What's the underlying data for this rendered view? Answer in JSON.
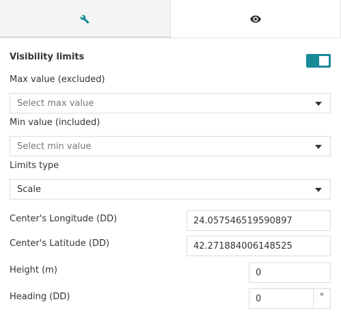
{
  "tabs": [
    {
      "icon": "wrench-icon",
      "active": true
    },
    {
      "icon": "eye-icon",
      "active": false
    }
  ],
  "visibility_limits": {
    "title": "Visibility limits",
    "toggle_on": true,
    "max_label": "Max value (excluded)",
    "max_placeholder": "Select max value",
    "min_label": "Min value (included)",
    "min_placeholder": "Select min value",
    "type_label": "Limits type",
    "type_value": "Scale"
  },
  "fields": {
    "longitude_label": "Center's Longitude (DD)",
    "longitude_value": "24.057546519590897",
    "latitude_label": "Center's Latitude (DD)",
    "latitude_value": "42.271884006148525",
    "height_label": "Height (m)",
    "height_value": "0",
    "heading_label": "Heading (DD)",
    "heading_value": "0",
    "heading_unit": "°"
  },
  "colors": {
    "accent": "#198a98",
    "icon": "#198a98",
    "border": "#dcdcdc"
  }
}
